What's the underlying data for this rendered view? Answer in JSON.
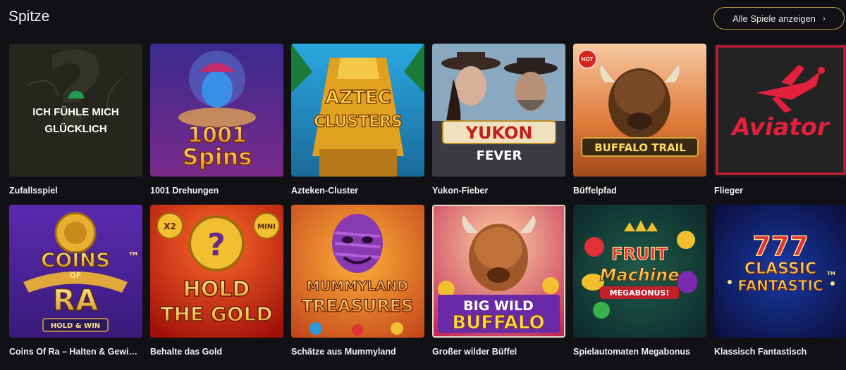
{
  "section": {
    "title": "Spitze",
    "all_games_label": "Alle Spiele anzeigen"
  },
  "random_game": {
    "overlay_line1": "ICH FÜHLE MICH",
    "overlay_line2": "GLÜCKLICH"
  },
  "games": [
    {
      "title": "Zufallsspiel"
    },
    {
      "title": "1001 Drehungen",
      "logo": [
        "1001",
        "Spins"
      ]
    },
    {
      "title": "Azteken-Cluster",
      "logo": [
        "AZTEC",
        "CLUSTERS"
      ]
    },
    {
      "title": "Yukon-Fieber",
      "logo": [
        "YUKON",
        "FEVER"
      ]
    },
    {
      "title": "Büffelpfad",
      "logo": [
        "BUFFALO TRAIL"
      ],
      "badge": "HOT"
    },
    {
      "title": "Flieger",
      "logo": [
        "Aviator"
      ]
    },
    {
      "title": "Coins Of Ra – Halten & Gewinnen",
      "logo": [
        "COINS",
        "OF",
        "RA",
        "HOLD & WIN",
        "TM"
      ]
    },
    {
      "title": "Behalte das Gold",
      "logo": [
        "HOLD",
        "THE GOLD",
        "X2",
        "MINI"
      ]
    },
    {
      "title": "Schätze aus Mummyland",
      "logo": [
        "MUMMYLAND",
        "TREASURES"
      ]
    },
    {
      "title": "Großer wilder Büffel",
      "logo": [
        "BIG WILD",
        "BUFFALO"
      ]
    },
    {
      "title": "Spielautomaten Megabonus",
      "logo": [
        "FRUIT",
        "Machine",
        "MEGABONUS!"
      ]
    },
    {
      "title": "Klassisch Fantastisch",
      "logo": [
        "777",
        "CLASSIC",
        "FANTASTIC",
        "TM"
      ]
    }
  ],
  "colors": {
    "background": "#111014",
    "button_border": "#b79a4a"
  }
}
